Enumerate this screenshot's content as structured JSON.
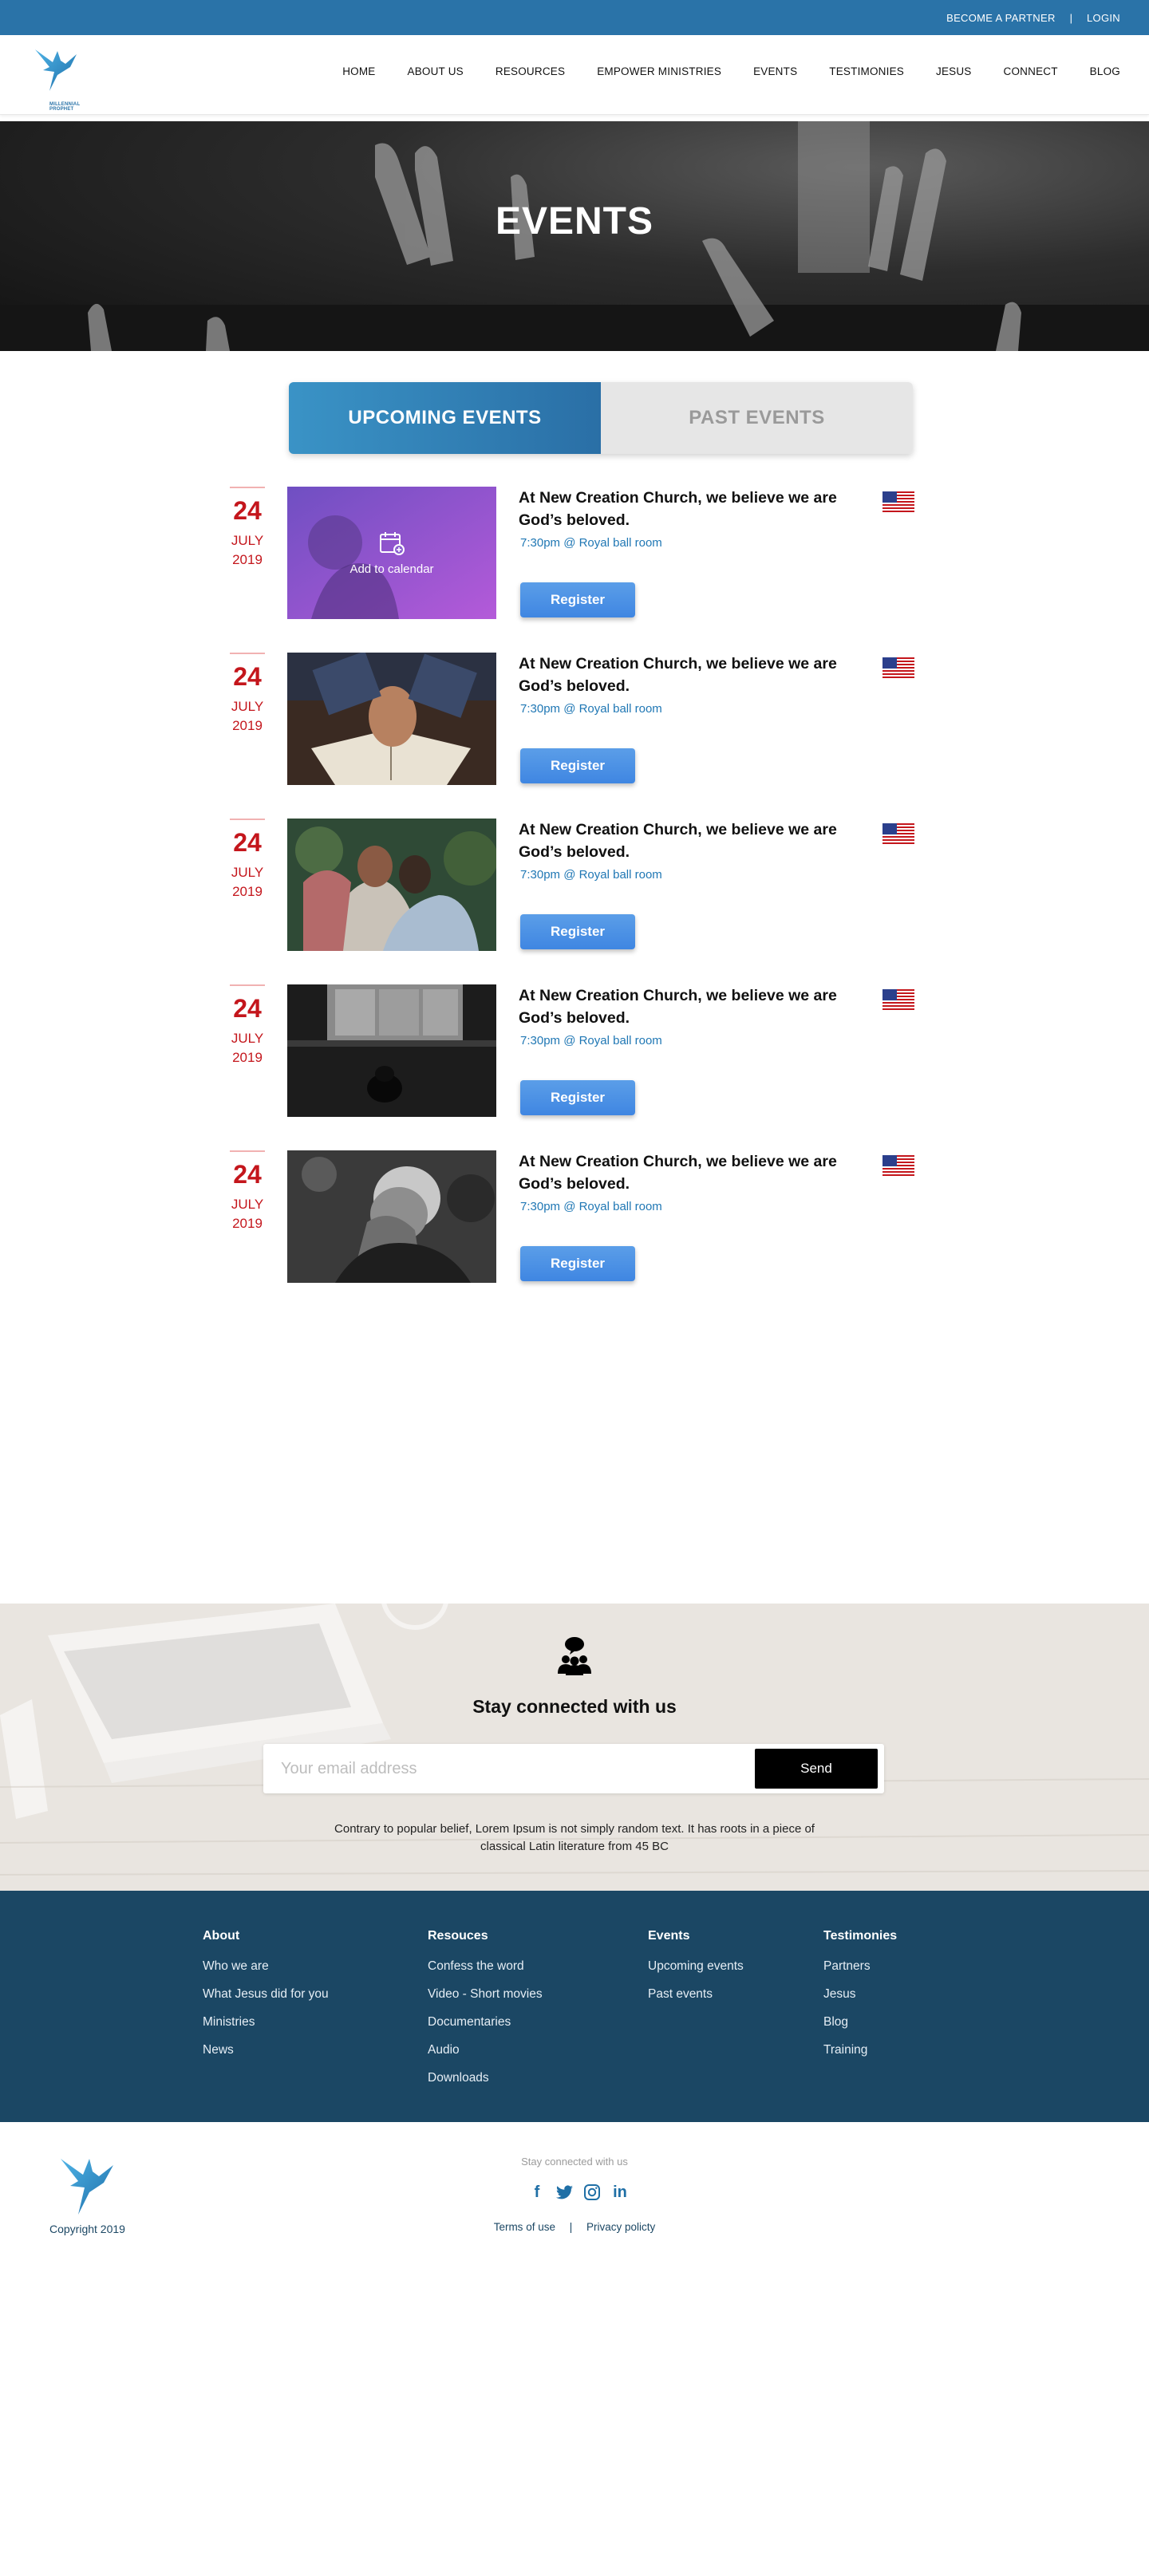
{
  "topbar": {
    "partner": "BECOME A PARTNER",
    "separator": "|",
    "login": "LOGIN"
  },
  "logo": {
    "text": "MILLENNIAL PROPHET"
  },
  "nav": [
    "HOME",
    "ABOUT US",
    "RESOURCES",
    "EMPOWER MINISTRIES",
    "EVENTS",
    "TESTIMONIES",
    "JESUS",
    "CONNECT",
    "BLOG"
  ],
  "hero": {
    "title": "EVENTS"
  },
  "tabs": {
    "upcoming": "UPCOMING EVENTS",
    "past": "PAST EVENTS"
  },
  "add_to_calendar": "Add to calendar",
  "events": [
    {
      "day": "24",
      "month": "JULY",
      "year": "2019",
      "title": "At New Creation Church, we believe we are God’s beloved.",
      "meta": "7:30pm @ Royal ball room",
      "button": "Register",
      "image": "woman-praying"
    },
    {
      "day": "24",
      "month": "JULY",
      "year": "2019",
      "title": "At New Creation Church, we believe we are God’s beloved.",
      "meta": "7:30pm @ Royal ball room",
      "button": "Register",
      "image": "hands-on-bible"
    },
    {
      "day": "24",
      "month": "JULY",
      "year": "2019",
      "title": "At New Creation Church, we believe we are God’s beloved.",
      "meta": "7:30pm @ Royal ball room",
      "button": "Register",
      "image": "group-praying"
    },
    {
      "day": "24",
      "month": "JULY",
      "year": "2019",
      "title": "At New Creation Church, we believe we are God’s beloved.",
      "meta": "7:30pm @ Royal ball room",
      "button": "Register",
      "image": "person-kneeling"
    },
    {
      "day": "24",
      "month": "JULY",
      "year": "2019",
      "title": "At New Creation Church, we believe we are God’s beloved.",
      "meta": "7:30pm @ Royal ball room",
      "button": "Register",
      "image": "old-man-praying"
    }
  ],
  "newsletter": {
    "title": "Stay connected with us",
    "placeholder": "Your email address",
    "button": "Send",
    "text": "Contrary to popular belief, Lorem Ipsum is not simply random text. It has roots in a piece of classical Latin literature from 45 BC"
  },
  "footer": {
    "columns": [
      {
        "heading": "About",
        "links": [
          "Who we are",
          "What Jesus did for you",
          "Ministries",
          "News"
        ]
      },
      {
        "heading": "Resouces",
        "links": [
          "Confess the word",
          "Video - Short movies",
          "Documentaries",
          "Audio",
          "Downloads"
        ]
      },
      {
        "heading": "Events",
        "links": [
          "Upcoming events",
          "Past events"
        ]
      },
      {
        "heading": "Testimonies",
        "links": [
          "Partners",
          "Jesus",
          "Blog",
          "Training"
        ]
      }
    ]
  },
  "bottom": {
    "copyright": "Copyright 2019",
    "stay": "Stay connected with us",
    "social": [
      "f",
      "t",
      "◎",
      "in"
    ],
    "terms": "Terms of use",
    "separator": "|",
    "privacy": "Privacy policty"
  },
  "colors": {
    "brand": "#2a73a8",
    "accent_red": "#c4161c",
    "footer": "#1b4764",
    "button": "#3f86e2"
  }
}
